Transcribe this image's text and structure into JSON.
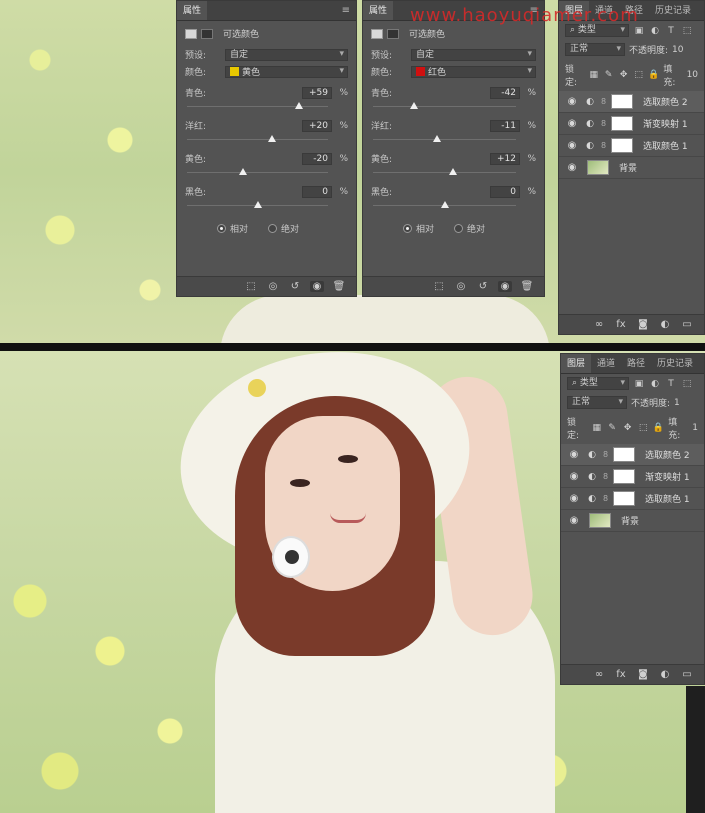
{
  "watermark": "www.haoyuqiamer.com",
  "panel_a": {
    "tab": "属性",
    "menu": "≡",
    "title": "可选颜色",
    "preset_label": "预设:",
    "preset_value": "自定",
    "color_label": "颜色:",
    "color_value": "黄色",
    "color_hex": "#e8c800",
    "sliders": [
      {
        "label": "青色:",
        "value": "+59",
        "level": 0.795
      },
      {
        "label": "洋红:",
        "value": "+20",
        "level": 0.6
      },
      {
        "label": "黄色:",
        "value": "-20",
        "level": 0.4
      },
      {
        "label": "黑色:",
        "value": "0",
        "level": 0.5
      }
    ],
    "pct": "%",
    "radio_relative": "相对",
    "radio_absolute": "绝对"
  },
  "panel_b": {
    "tab": "属性",
    "menu": "≡",
    "title": "可选颜色",
    "preset_label": "预设:",
    "preset_value": "自定",
    "color_label": "颜色:",
    "color_value": "红色",
    "color_hex": "#d01010",
    "sliders": [
      {
        "label": "青色:",
        "value": "-42",
        "level": 0.29
      },
      {
        "label": "洋红:",
        "value": "-11",
        "level": 0.445
      },
      {
        "label": "黄色:",
        "value": "+12",
        "level": 0.56
      },
      {
        "label": "黑色:",
        "value": "0",
        "level": 0.5
      }
    ],
    "pct": "%",
    "radio_relative": "相对",
    "radio_absolute": "绝对"
  },
  "layers_top": {
    "tabs": [
      "图层",
      "通道",
      "路径",
      "历史记录"
    ],
    "filter_label": "类型",
    "blend_mode": "正常",
    "opacity_label": "不透明度:",
    "opacity_value": "10",
    "lock_label": "锁定:",
    "fill_label": "填充:",
    "fill_value": "10",
    "layers": [
      {
        "name": "选取颜色 2"
      },
      {
        "name": "渐变映射 1"
      },
      {
        "name": "选取颜色 1"
      },
      {
        "name": "背景"
      }
    ]
  },
  "layers_bottom": {
    "tabs": [
      "图层",
      "通道",
      "路径",
      "历史记录"
    ],
    "filter_label": "类型",
    "blend_mode": "正常",
    "opacity_label": "不透明度:",
    "opacity_value": "1",
    "lock_label": "锁定:",
    "fill_label": "填充:",
    "fill_value": "1",
    "layers": [
      {
        "name": "选取颜色 2"
      },
      {
        "name": "渐变映射 1"
      },
      {
        "name": "选取颜色 1"
      },
      {
        "name": "背景"
      }
    ]
  }
}
